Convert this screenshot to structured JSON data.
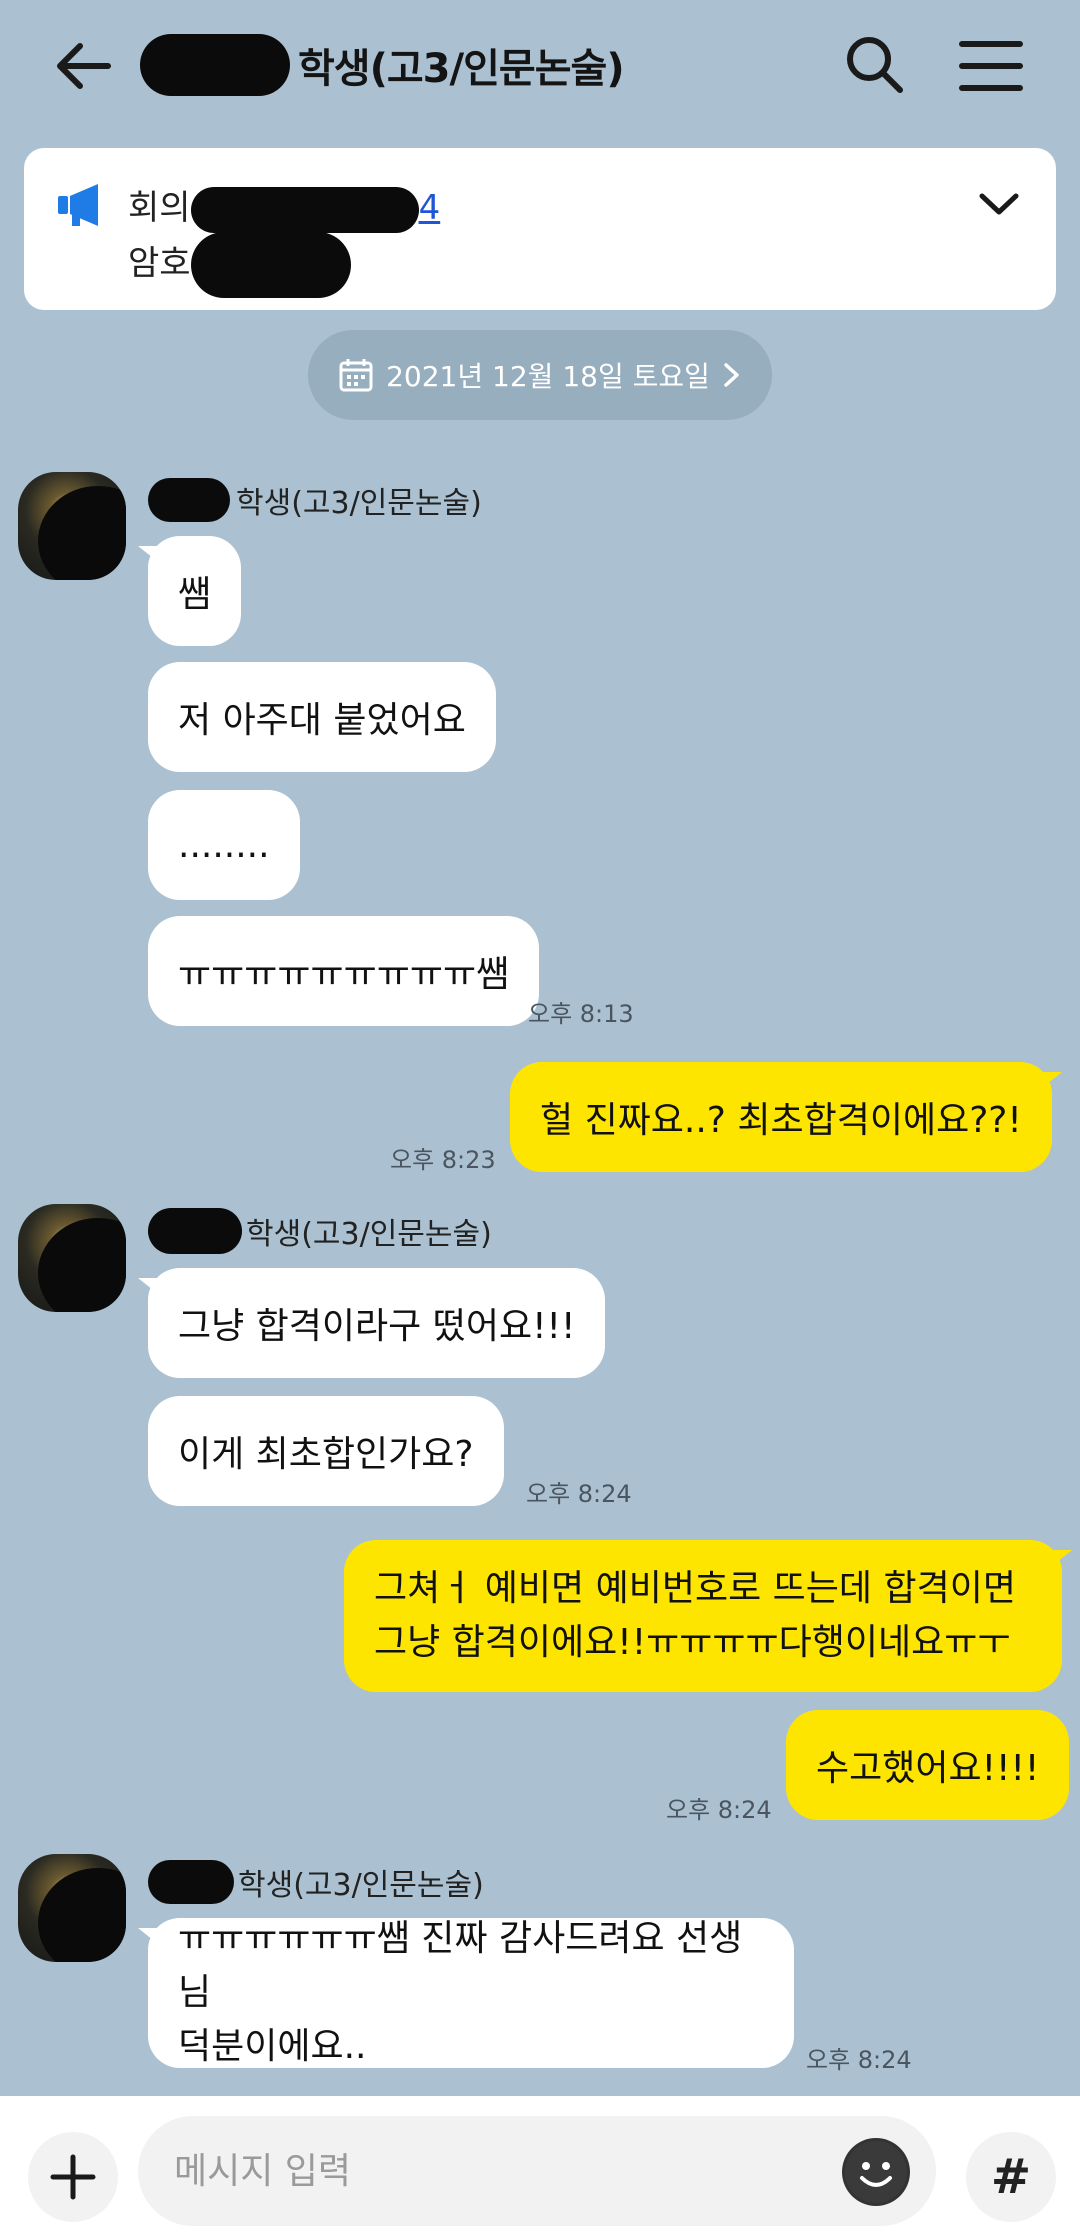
{
  "header": {
    "title": "학생(고3/인문논술)"
  },
  "notice": {
    "line1_prefix": "회의",
    "line1_link_tail": "4",
    "line2_prefix": "암호"
  },
  "date_pill": {
    "label": "2021년 12월 18일 토요일"
  },
  "messages": [
    {
      "sender": "학생(고3/인문논술)",
      "text": "쌤"
    },
    {
      "text": "저 아주대 붙었어요"
    },
    {
      "text": "........"
    },
    {
      "text": "ㅠㅠㅠㅠㅠㅠㅠㅠㅠ쌤",
      "time": "오후 8:13"
    },
    {
      "mine": true,
      "text": "헐 진짜요..? 최초합격이에요??!",
      "time": "오후 8:23"
    },
    {
      "sender": "학생(고3/인문논술)",
      "text": "그냥 합격이라구 떴어요!!!"
    },
    {
      "text": "이게 최초합인가요?",
      "time": "오후 8:24"
    },
    {
      "mine": true,
      "text_line1": "그쳐ㅓ 예비면 예비번호로 뜨는데 합격이면",
      "text_line2": "그냥 합격이에요!!ㅠㅠㅠㅠ다행이네요ㅠㅜ"
    },
    {
      "mine": true,
      "text": "수고했어요!!!!",
      "time": "오후 8:24"
    },
    {
      "sender": "학생(고3/인문논술)",
      "text_line1": "ㅠㅠㅠㅠㅠㅠ쌤 진짜 감사드려요 선생님",
      "text_line2": "덕분이에요..",
      "time": "오후 8:24"
    }
  ],
  "input": {
    "placeholder": "메시지 입력",
    "hash_label": "#"
  },
  "colors": {
    "background": "#abc1d1",
    "my_bubble": "#fee500",
    "their_bubble": "#ffffff",
    "notice_icon": "#1f7be6",
    "link": "#1f56d8"
  }
}
